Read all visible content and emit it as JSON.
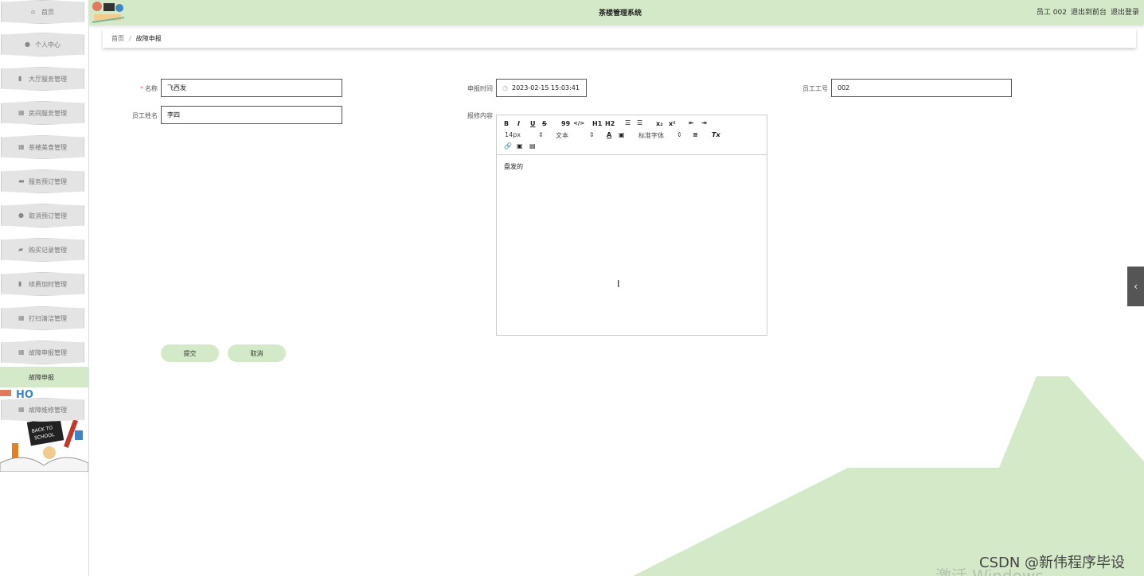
{
  "app": {
    "title": "茶楼管理系统",
    "user": "员工 002",
    "back_to_front": "退出到前台",
    "logout": "退出登录"
  },
  "sidebar": {
    "items": [
      {
        "label": "首页",
        "icon": "home-icon"
      },
      {
        "label": "个人中心",
        "icon": "user-icon"
      },
      {
        "label": "大厅服务管理",
        "icon": "clipboard-icon"
      },
      {
        "label": "房间服务管理",
        "icon": "grid-icon"
      },
      {
        "label": "茶楼美食管理",
        "icon": "grid-icon"
      },
      {
        "label": "服务预订管理",
        "icon": "monitor-icon"
      },
      {
        "label": "取消预订管理",
        "icon": "user-icon"
      },
      {
        "label": "购买记录管理",
        "icon": "chat-icon"
      },
      {
        "label": "续费加时管理",
        "icon": "clipboard-icon"
      },
      {
        "label": "打扫清洁管理",
        "icon": "grid-icon"
      },
      {
        "label": "故障申报管理",
        "icon": "grid-icon"
      }
    ],
    "active_sub": "故障申报",
    "after_item": {
      "label": "故障维修管理",
      "icon": "table-icon"
    }
  },
  "breadcrumb": {
    "home": "首页",
    "sep": "/",
    "current": "故障申报"
  },
  "form": {
    "name_label": "名称",
    "name_value": "飞西发",
    "time_label": "申报时间",
    "time_value": "2023-02-15 15:03:41",
    "empno_label": "员工工号",
    "empno_value": "002",
    "empname_label": "员工姓名",
    "empname_value": "李四",
    "content_label": "报修内容",
    "content_value": "盘发的",
    "toolbar": {
      "bold": "B",
      "italic": "I",
      "underline": "U",
      "strike": "S",
      "quote": "99",
      "code": "</>",
      "h1": "H1",
      "h2": "H2",
      "sub": "x₂",
      "sup": "x²",
      "clean": "Tx",
      "size": "14px",
      "para": "文本",
      "font": "标准字体"
    },
    "submit": "提交",
    "cancel": "取消"
  },
  "watermarks": {
    "csdn": "CSDN @新伟程序毕设",
    "windows": "激活 Windows"
  }
}
